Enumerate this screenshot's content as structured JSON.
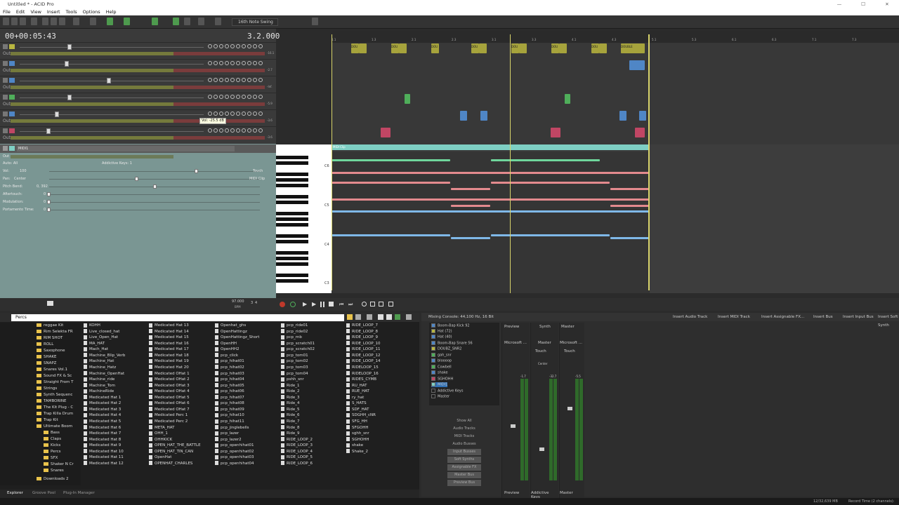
{
  "window": {
    "title": "Untitled * - ACID Pro",
    "minimize": "—",
    "maximize": "☐",
    "close": "✕"
  },
  "menu": [
    "File",
    "Edit",
    "View",
    "Insert",
    "Tools",
    "Options",
    "Help"
  ],
  "toolbar": {
    "swing": "16th Note Swing"
  },
  "time": {
    "position": "00+00:05:43",
    "beat": "3.2.000"
  },
  "tracks": [
    {
      "num": "1",
      "color": "#b8b640",
      "out": "Out",
      "db": "-16.1"
    },
    {
      "num": "2",
      "color": "#4f86c6",
      "out": "Out",
      "db": "-2.7"
    },
    {
      "num": "3",
      "color": "#4f86c6",
      "out": "Out",
      "db": "-Inf."
    },
    {
      "num": "4",
      "color": "#4fae5a",
      "out": "Out",
      "db": "-5.9"
    },
    {
      "num": "5",
      "color": "#4f86c6",
      "out": "Out",
      "db": "-3.6"
    },
    {
      "num": "6",
      "color": "#c04664",
      "out": "Out",
      "db": "-3.6"
    }
  ],
  "tooltip": "Vol: -25.5 dB",
  "midi_track": {
    "name": "MIDI1",
    "out": "Out",
    "instrument": "Addictive Keys: 1",
    "auto": "Auto: All",
    "vol_label": "Vol:",
    "vol_value": "100",
    "pan_label": "Pan:",
    "pan_value": "Center",
    "pitch_label": "Pitch Bend:",
    "pitch_value": "0, 392",
    "after_label": "Aftertouch:",
    "after_value": "0",
    "mod_label": "Modulation:",
    "mod_value": "0",
    "porta_label": "Portamento Time:",
    "porta_value": "0",
    "touch": "Touch",
    "clip": "MIDI Clip"
  },
  "ruler": [
    "1.1",
    "1.3",
    "2.1",
    "2.3",
    "3.1",
    "3.3",
    "4.1",
    "4.3",
    "5.1",
    "5.3",
    "6.1",
    "6.3",
    "7.1",
    "7.3"
  ],
  "clip_labels": {
    "hat": "DOU",
    "hat_last": "DOUBLE",
    "midi_clip": "MIDI Clip"
  },
  "piano_labels": [
    "C6",
    "C5",
    "C4",
    "C3"
  ],
  "tempo": {
    "bpm": "97.000",
    "bpm_label": "BPM",
    "sig": "3",
    "sig_label": "4"
  },
  "explorer": {
    "path": "Percs",
    "tree": [
      "reggae Kit",
      "Rim Selekta FR",
      "RIM SHOT",
      "ROLL",
      "Saxophone",
      "SHAKE",
      "SNAPZ",
      "Snares Vol.1",
      "Sound FX & Sc",
      "Straight From T",
      "Strings",
      "Synth Sequenc",
      "TAMBORINE",
      "The Kit Plug - C",
      "Trap Killa Drum",
      "Trap Kit",
      "Ultimate Boom",
      "Bass",
      "Claps",
      "Kicks",
      "Percs",
      "SFX",
      "Shaker N Cr",
      "Snares",
      "Downloads 2"
    ],
    "col1": [
      "KOHH",
      "Live_closed_hat",
      "Live_Open_Hat",
      "MA_HAT",
      "Mach_Hat",
      "Machine_Blip_Verb",
      "Machine_Hat",
      "Machine_Hatz",
      "Machine_OpenHat",
      "Machine_ride",
      "Machine_Tom",
      "MachineRide",
      "Medicated Hat 1",
      "Medicated Hat 2",
      "Medicated Hat 3",
      "Medicated Hat 4",
      "Medicated Hat 5",
      "Medicated Hat 6",
      "Medicated Hat 7",
      "Medicated Hat 8",
      "Medicated Hat 9",
      "Medicated Hat 10",
      "Medicated Hat 11",
      "Medicated Hat 12"
    ],
    "col2": [
      "Medicated Hat 13",
      "Medicated Hat 14",
      "Medicated Hat 15",
      "Medicated Hat 16",
      "Medicated Hat 17",
      "Medicated Hat 18",
      "Medicated Hat 19",
      "Medicated Hat 20",
      "Medicated OHat 1",
      "Medicated OHat 2",
      "Medicated OHat 3",
      "Medicated OHat 4",
      "Medicated OHat 5",
      "Medicated OHat 6",
      "Medicated OHat 7",
      "Medicated Perc 1",
      "Medicated Perc 2",
      "META_HAT",
      "OHH_1",
      "OHHKICK",
      "OPEN_HAT_THE_BATTLE",
      "OPEN_HAT_TIN_CAN",
      "OpenHat",
      "OPENHAT_CHARLES"
    ],
    "col3": [
      "Openhat_ghs",
      "OpenHattingz",
      "OpenHattingz_Short",
      "OpenHH",
      "OpenHH2",
      "pcp_click",
      "pcp_hihat01",
      "pcp_hihat02",
      "pcp_hihat03",
      "pcp_hihat04",
      "pcp_hihat05",
      "pcp_hihat06",
      "pcp_hihat07",
      "pcp_hihat08",
      "pcp_hihat09",
      "pcp_hihat10",
      "pcp_hihat11",
      "pcp_jinglebells",
      "pcp_lazer",
      "pcp_lazer2",
      "pcp_openhihat01",
      "pcp_openhihat02",
      "pcp_openhihat03",
      "pcp_openhihat04"
    ],
    "col4": [
      "pcp_ride01",
      "pcp_ride02",
      "pcp_rnb",
      "pcp_scratch01",
      "pcp_scratch02",
      "pcp_tom01",
      "pcp_tom02",
      "pcp_tom03",
      "pcp_tom04",
      "pshh_snr",
      "Ride_1",
      "Ride_2",
      "Ride_3",
      "Ride_4",
      "Ride_5",
      "Ride_6",
      "Ride_7",
      "Ride_8",
      "Ride_9",
      "RIDE_LOOP_2",
      "RIDE_LOOP_3",
      "RIDE_LOOP_4",
      "RIDE_LOOP_5",
      "RIDE_LOOP_6"
    ],
    "col5": [
      "RIDE_LOOP_7",
      "RIDE_LOOP_8",
      "RIDE_LOOP_9",
      "RIDE_LOOP_10",
      "RIDE_LOOP_11",
      "RIDE_LOOP_12",
      "RIDE_LOOP_14",
      "RIDELOOP_15",
      "RIDELOOP_16",
      "RIDES_CYMB",
      "RU_HAT",
      "RUE_HAT",
      "ry_hat",
      "S_HATS",
      "SDF_HAT",
      "SDGHH_cNR",
      "SFG_HH",
      "SFGOHH",
      "sghh_snr",
      "SGHOHH",
      "shake",
      "Shake_2"
    ],
    "tabs": [
      "Explorer",
      "Groove Pool",
      "Plug-In Manager"
    ]
  },
  "mixer": {
    "title": "Mixing Console: 44,100 Hz, 16 Bit",
    "buttons": [
      "Insert Audio Track",
      "Insert MIDI Track",
      "Insert Assignable FX...",
      "Insert Bus",
      "Insert Input Bus",
      "Insert Soft Synth"
    ],
    "list": [
      "Boom-Bap Kick 92",
      "Hat (72)",
      "Hat (40)",
      "Boom-Bap Snare 56",
      "DOUBZ_SNR2",
      "gah_snr",
      "bloooop",
      "Cowbell",
      "shake",
      "SGHOHH",
      "MIDI1",
      "Addictive Keys",
      "Master"
    ],
    "views": [
      "Show All",
      "Audio Tracks",
      "MIDI Tracks",
      "Audio Busses",
      "Input Busses",
      "Soft Synths",
      "Assignable FX",
      "Master Bus",
      "Preview Bus"
    ],
    "strips": [
      {
        "top": "Preview",
        "name": "Microsoft ...",
        "bottom": "Preview",
        "db": "-1.7"
      },
      {
        "top": "Synth",
        "name": "Master",
        "bottom": "Addictive Keys",
        "db": "-32.7"
      },
      {
        "top": "Master",
        "name": "Microsoft ...",
        "bottom": "Master",
        "db": "-5.5"
      }
    ],
    "touch": "Touch",
    "center": "Center"
  },
  "status": {
    "memory": "12/32,639 MB",
    "record": "Record Time (2 channels):"
  }
}
